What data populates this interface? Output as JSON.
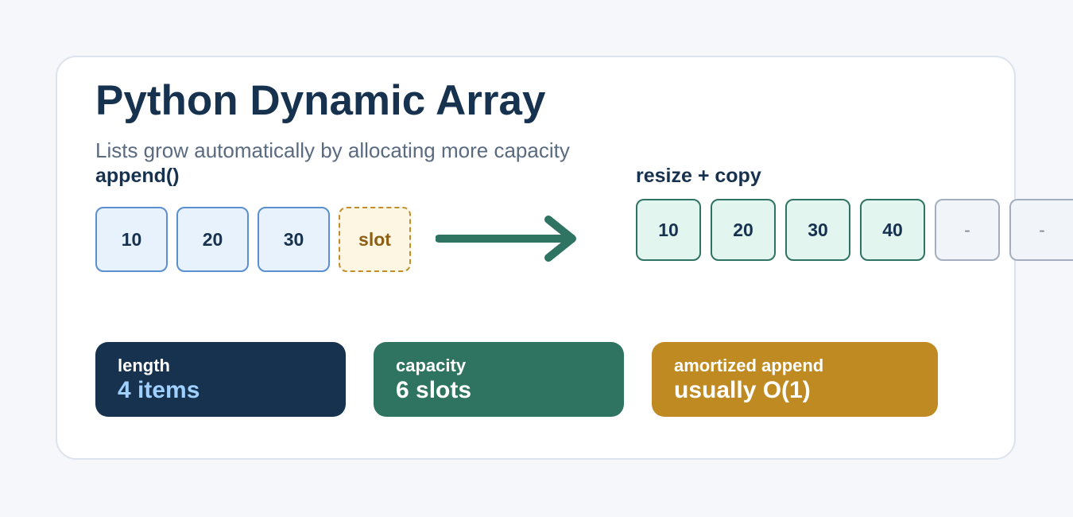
{
  "title": "Python Dynamic Array",
  "subtitle": "Lists grow automatically by allocating more capacity",
  "append": {
    "label": "append()",
    "cells": [
      "10",
      "20",
      "30"
    ],
    "slot": "slot"
  },
  "resize": {
    "label": "resize + copy",
    "cells": [
      "10",
      "20",
      "30",
      "40"
    ],
    "empty": [
      "-",
      "-"
    ]
  },
  "stats": {
    "length": {
      "label": "length",
      "value": "4 items"
    },
    "capacity": {
      "label": "capacity",
      "value": "6 slots"
    },
    "amortized": {
      "label": "amortized append",
      "value": "usually O(1)"
    }
  },
  "colors": {
    "navy": "#17324f",
    "green": "#2f7461",
    "gold": "#c08a22",
    "blue_cell": "#e8f2fd",
    "green_cell": "#e2f5ee",
    "slot_fill": "#fdf6e3",
    "arrow": "#2f7463"
  }
}
